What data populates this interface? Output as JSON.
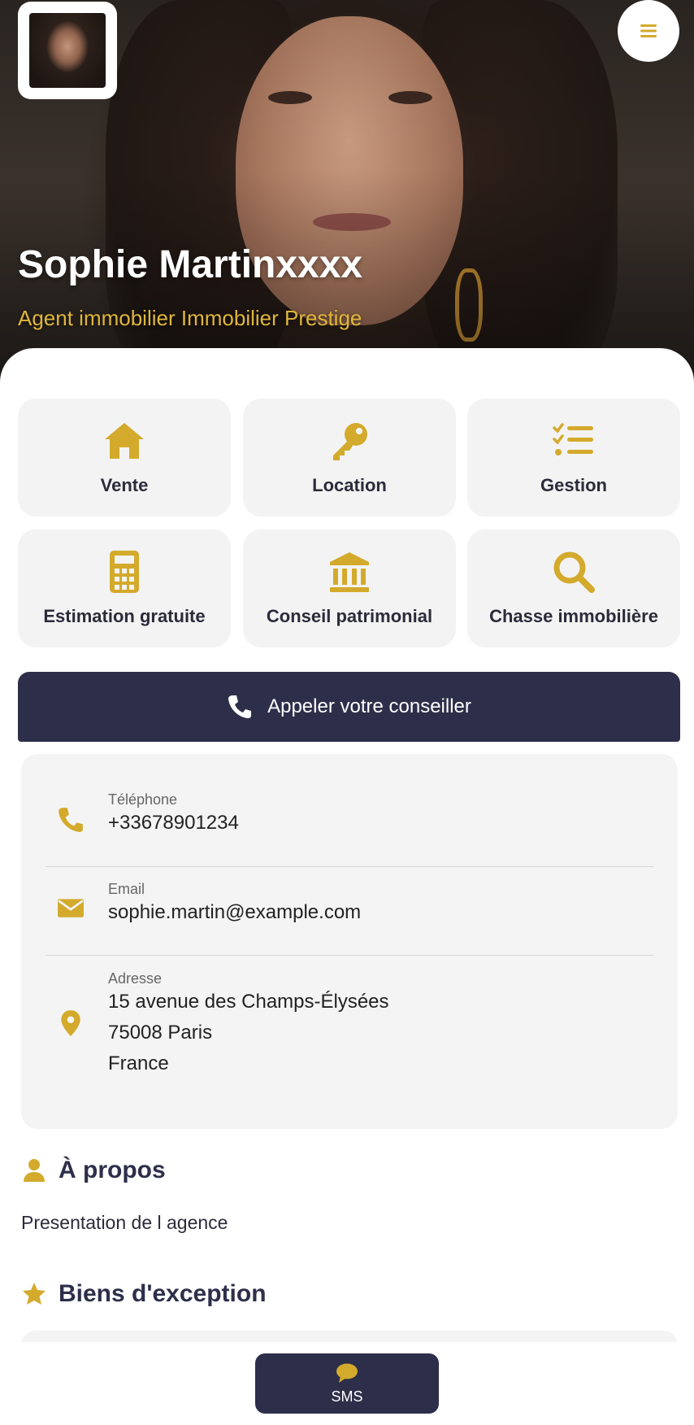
{
  "colors": {
    "accent": "#d4aa2c",
    "navy": "#2d2f4a",
    "tile_bg": "#f3f3f3"
  },
  "header": {
    "name": "Sophie Martinxxxx",
    "role": "Agent immobilier Immobilier Prestige",
    "menu_icon": "hamburger-icon"
  },
  "services": [
    {
      "label": "Vente",
      "icon": "house-icon"
    },
    {
      "label": "Location",
      "icon": "key-icon"
    },
    {
      "label": "Gestion",
      "icon": "checklist-icon"
    },
    {
      "label": "Estimation gratuite",
      "icon": "calculator-icon"
    },
    {
      "label": "Conseil patrimonial",
      "icon": "bank-icon"
    },
    {
      "label": "Chasse immobilière",
      "icon": "search-icon"
    }
  ],
  "call_button": {
    "label": "Appeler votre conseiller",
    "icon": "phone-icon"
  },
  "contact": {
    "phone_label": "Téléphone",
    "phone": "+33678901234",
    "email_label": "Email",
    "email": "sophie.martin@example.com",
    "address_label": "Adresse",
    "address_line1": "15 avenue des Champs-Élysées",
    "address_line2": "75008 Paris",
    "address_line3": "France"
  },
  "about": {
    "title": "À propos",
    "text": "Presentation de l agence",
    "icon": "user-icon"
  },
  "exceptional": {
    "title": "Biens d'exception",
    "icon": "star-icon"
  },
  "bottom_bar": {
    "sms_label": "SMS",
    "icon": "chat-bubble-icon"
  }
}
